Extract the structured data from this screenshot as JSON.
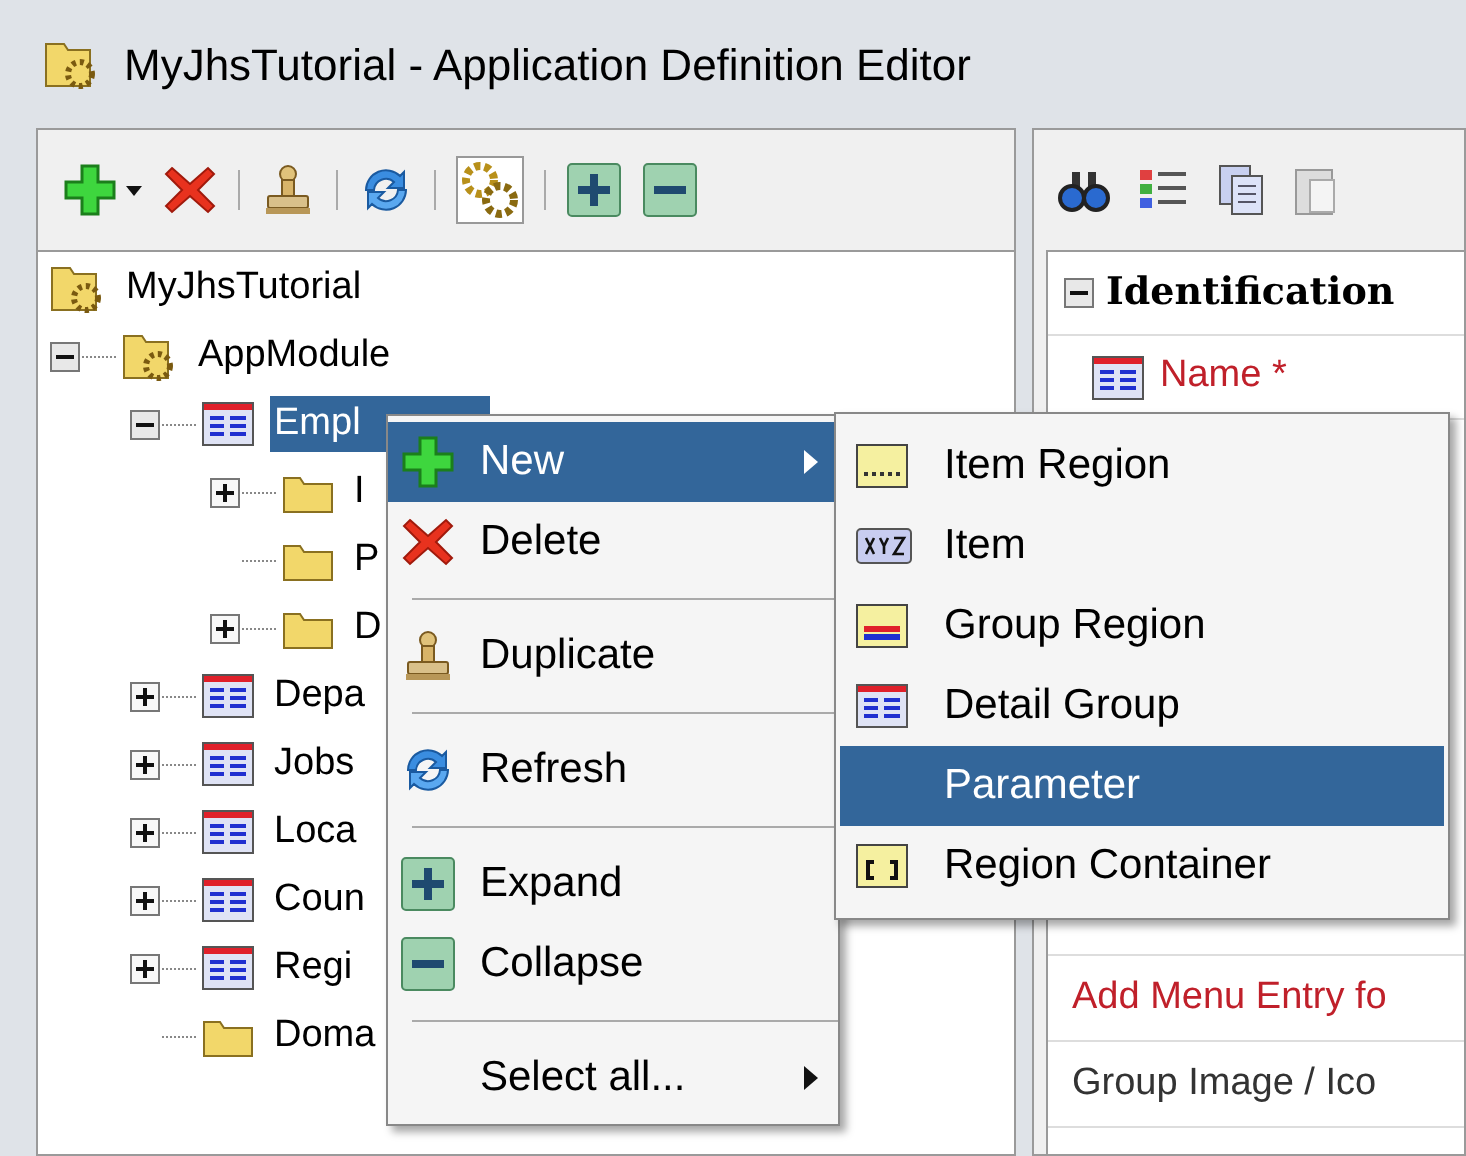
{
  "window": {
    "title": "MyJhsTutorial - Application Definition Editor"
  },
  "tree": [
    {
      "label": "MyJhsTutorial",
      "kind": "application",
      "selected": false,
      "children": [
        {
          "label": "AppModule",
          "kind": "module",
          "expanded": true,
          "selected": false,
          "children": [
            {
              "label": "Empl",
              "kind": "group",
              "expanded": true,
              "selected": true,
              "children": [
                {
                  "label": "I",
                  "kind": "folder",
                  "expanded": false,
                  "selected": false
                },
                {
                  "label": "P",
                  "kind": "folder",
                  "selected": false
                },
                {
                  "label": "D",
                  "kind": "folder",
                  "expanded": false,
                  "selected": false
                }
              ]
            },
            {
              "label": "Depa",
              "kind": "group",
              "expanded": false,
              "selected": false
            },
            {
              "label": "Jobs",
              "kind": "group",
              "expanded": false,
              "selected": false
            },
            {
              "label": "Loca",
              "kind": "group",
              "expanded": false,
              "selected": false
            },
            {
              "label": "Coun",
              "kind": "group",
              "expanded": false,
              "selected": false
            },
            {
              "label": "Regi",
              "kind": "group",
              "expanded": false,
              "selected": false
            },
            {
              "label": "Doma",
              "kind": "folder",
              "selected": false
            }
          ]
        }
      ]
    }
  ],
  "properties": {
    "section": {
      "label": "Identification",
      "expanded": true
    },
    "top_rows": [
      {
        "label": "Name *",
        "required": true
      }
    ],
    "bottom_rows": [
      {
        "label": "Add Menu Entry fo",
        "required": true
      },
      {
        "label": "Group Image / Ico",
        "required": false
      }
    ]
  },
  "context_menu": [
    {
      "label": "New",
      "kind": "new",
      "selected": true,
      "submenu": true,
      "separator_before": false
    },
    {
      "label": "Delete",
      "kind": "delete",
      "selected": false,
      "submenu": false,
      "separator_before": false
    },
    {
      "label": "Duplicate",
      "kind": "duplicate",
      "selected": false,
      "submenu": false,
      "separator_before": true
    },
    {
      "label": "Refresh",
      "kind": "refresh",
      "selected": false,
      "submenu": false,
      "separator_before": true
    },
    {
      "label": "Expand",
      "kind": "expand",
      "selected": false,
      "submenu": false,
      "separator_before": true
    },
    {
      "label": "Collapse",
      "kind": "collapse",
      "selected": false,
      "submenu": false,
      "separator_before": false
    },
    {
      "label": "Select all...",
      "kind": "plain",
      "selected": false,
      "submenu": true,
      "separator_before": true
    }
  ],
  "submenu": [
    {
      "label": "Item Region",
      "kind": "item-region",
      "selected": false
    },
    {
      "label": "Item",
      "kind": "item",
      "selected": false
    },
    {
      "label": "Group Region",
      "kind": "group-region",
      "selected": false
    },
    {
      "label": "Detail Group",
      "kind": "detail-group",
      "selected": false
    },
    {
      "label": "Parameter",
      "kind": "plain",
      "selected": true
    },
    {
      "label": "Region Container",
      "kind": "region-container",
      "selected": false
    }
  ]
}
